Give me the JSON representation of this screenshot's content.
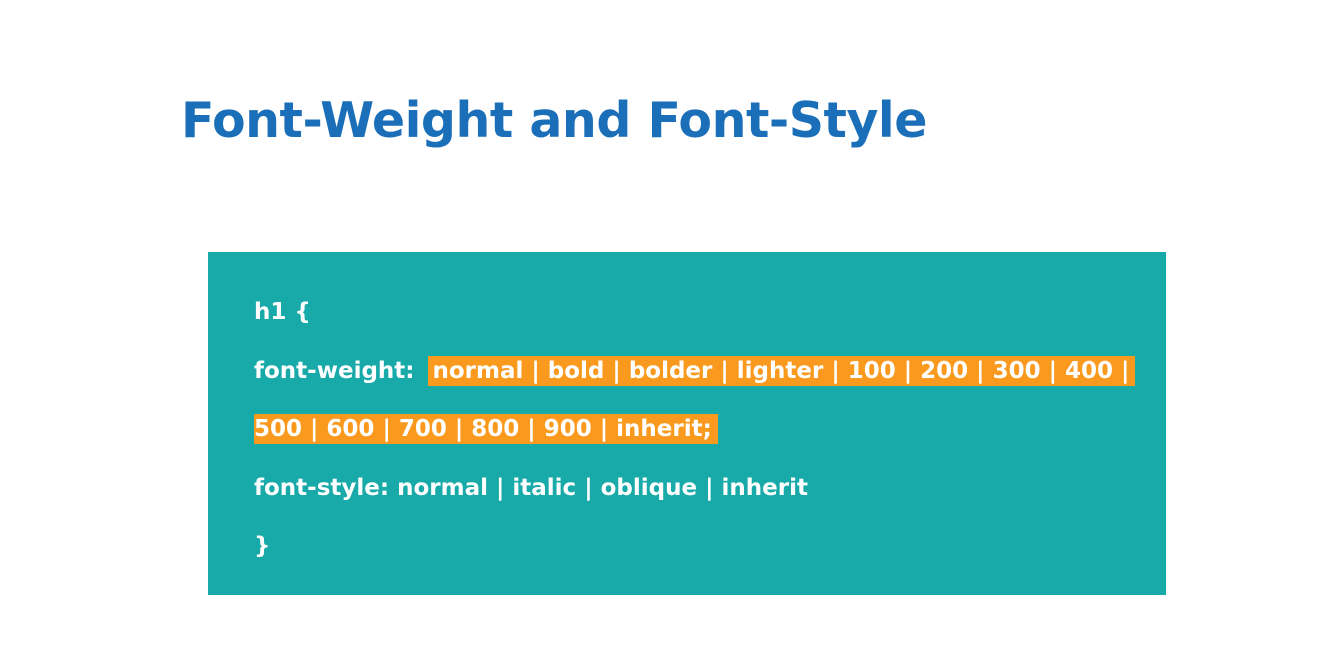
{
  "slide": {
    "title": "Font-Weight and Font-Style",
    "code": {
      "selector_open": "h1 {",
      "font_weight_property": "font-weight:",
      "font_weight_values_line1": "normal | bold | bolder | lighter | 100 | 200 | 300 | 400 |",
      "font_weight_values_line2": "500 | 600 | 700 | 800 | 900 | inherit;",
      "font_style_line": "font-style: normal | italic | oblique | inherit",
      "selector_close": "}"
    }
  },
  "colors": {
    "title": "#1a6fb8",
    "code_background": "#17aaa8",
    "highlight": "#f99a1e",
    "code_text": "#ffffff"
  }
}
